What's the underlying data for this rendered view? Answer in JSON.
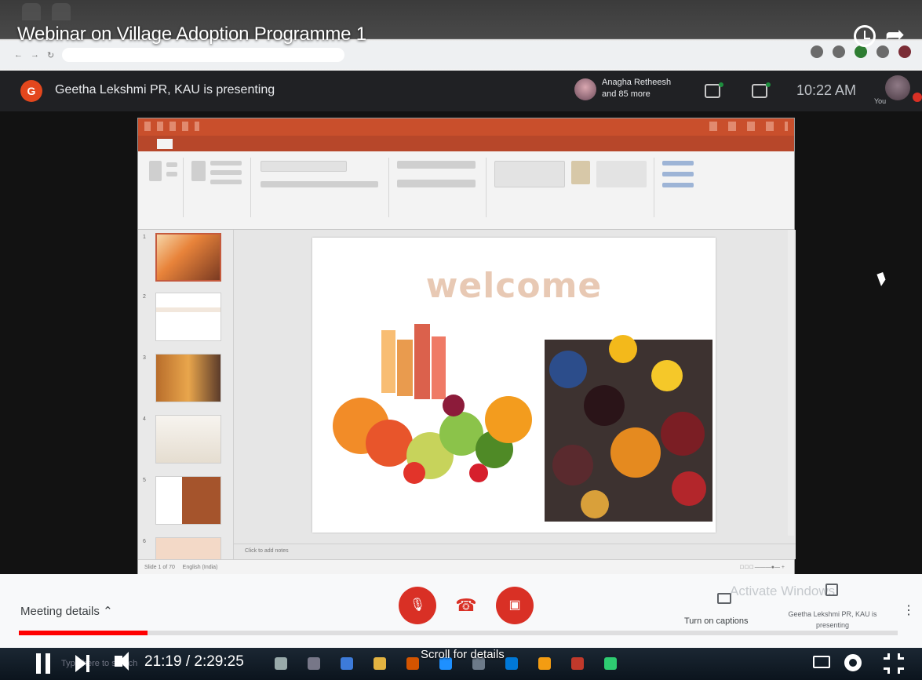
{
  "youtube": {
    "video_title": "Webinar on Village Adoption Programme 1",
    "current_time": "21:19",
    "duration": "2:29:25",
    "progress_fraction": 0.146,
    "scroll_hint": "Scroll for details",
    "progress_color": "#ff0000"
  },
  "meet": {
    "presenter_initial": "G",
    "presenter_text": "Geetha Lekshmi PR, KAU is presenting",
    "participants_text_line1": "Anagha Retheesh",
    "participants_text_line2": "and 85 more",
    "time": "10:22 AM",
    "you_label": "You",
    "meeting_details_label": "Meeting details",
    "captions_label": "Turn on captions",
    "presenting_label": "Geetha Lekshmi PR, KAU is presenting",
    "accent_red": "#d93025"
  },
  "windows": {
    "activate_line1": "Activate Windows",
    "search_placeholder": "Type here to search"
  },
  "powerpoint": {
    "slide_title": "welcome",
    "notes_placeholder": "Click to add notes",
    "slide_count_text": "Slide 1 of 70",
    "language": "English (India)",
    "accent": "#b7472a"
  }
}
